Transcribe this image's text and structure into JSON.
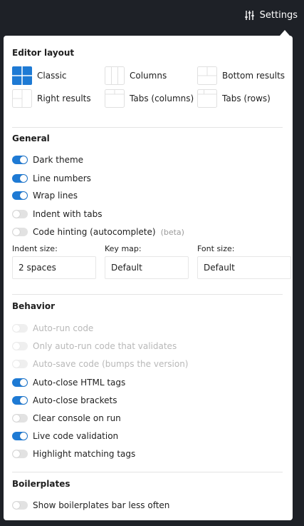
{
  "topbar": {
    "settings_label": "Settings",
    "settings_icon": "sliders-icon"
  },
  "colors": {
    "accent": "#1e7ad4",
    "topbar_bg": "#1e2127",
    "panel_bg": "#ffffff"
  },
  "editor_layout": {
    "title": "Editor layout",
    "options": [
      {
        "label": "Classic",
        "selected": true
      },
      {
        "label": "Columns",
        "selected": false
      },
      {
        "label": "Bottom results",
        "selected": false
      },
      {
        "label": "Right results",
        "selected": false
      },
      {
        "label": "Tabs (columns)",
        "selected": false
      },
      {
        "label": "Tabs (rows)",
        "selected": false
      }
    ]
  },
  "general": {
    "title": "General",
    "toggles": [
      {
        "label": "Dark theme",
        "on": true
      },
      {
        "label": "Line numbers",
        "on": true
      },
      {
        "label": "Wrap lines",
        "on": true
      },
      {
        "label": "Indent with tabs",
        "on": false
      },
      {
        "label": "Code hinting (autocomplete)",
        "extra": "(beta)",
        "on": false
      }
    ],
    "fields": [
      {
        "label": "Indent size:",
        "value": "2 spaces"
      },
      {
        "label": "Key map:",
        "value": "Default"
      },
      {
        "label": "Font size:",
        "value": "Default"
      }
    ]
  },
  "behavior": {
    "title": "Behavior",
    "toggles": [
      {
        "label": "Auto-run code",
        "on": false,
        "disabled": true
      },
      {
        "label": "Only auto-run code that validates",
        "on": false,
        "disabled": true
      },
      {
        "label": "Auto-save code (bumps the version)",
        "on": false,
        "disabled": true
      },
      {
        "label": "Auto-close HTML tags",
        "on": true
      },
      {
        "label": "Auto-close brackets",
        "on": true
      },
      {
        "label": "Clear console on run",
        "on": false
      },
      {
        "label": "Live code validation",
        "on": true
      },
      {
        "label": "Highlight matching tags",
        "on": false
      }
    ]
  },
  "boilerplates": {
    "title": "Boilerplates",
    "toggles": [
      {
        "label": "Show boilerplates bar less often",
        "on": false
      }
    ]
  }
}
